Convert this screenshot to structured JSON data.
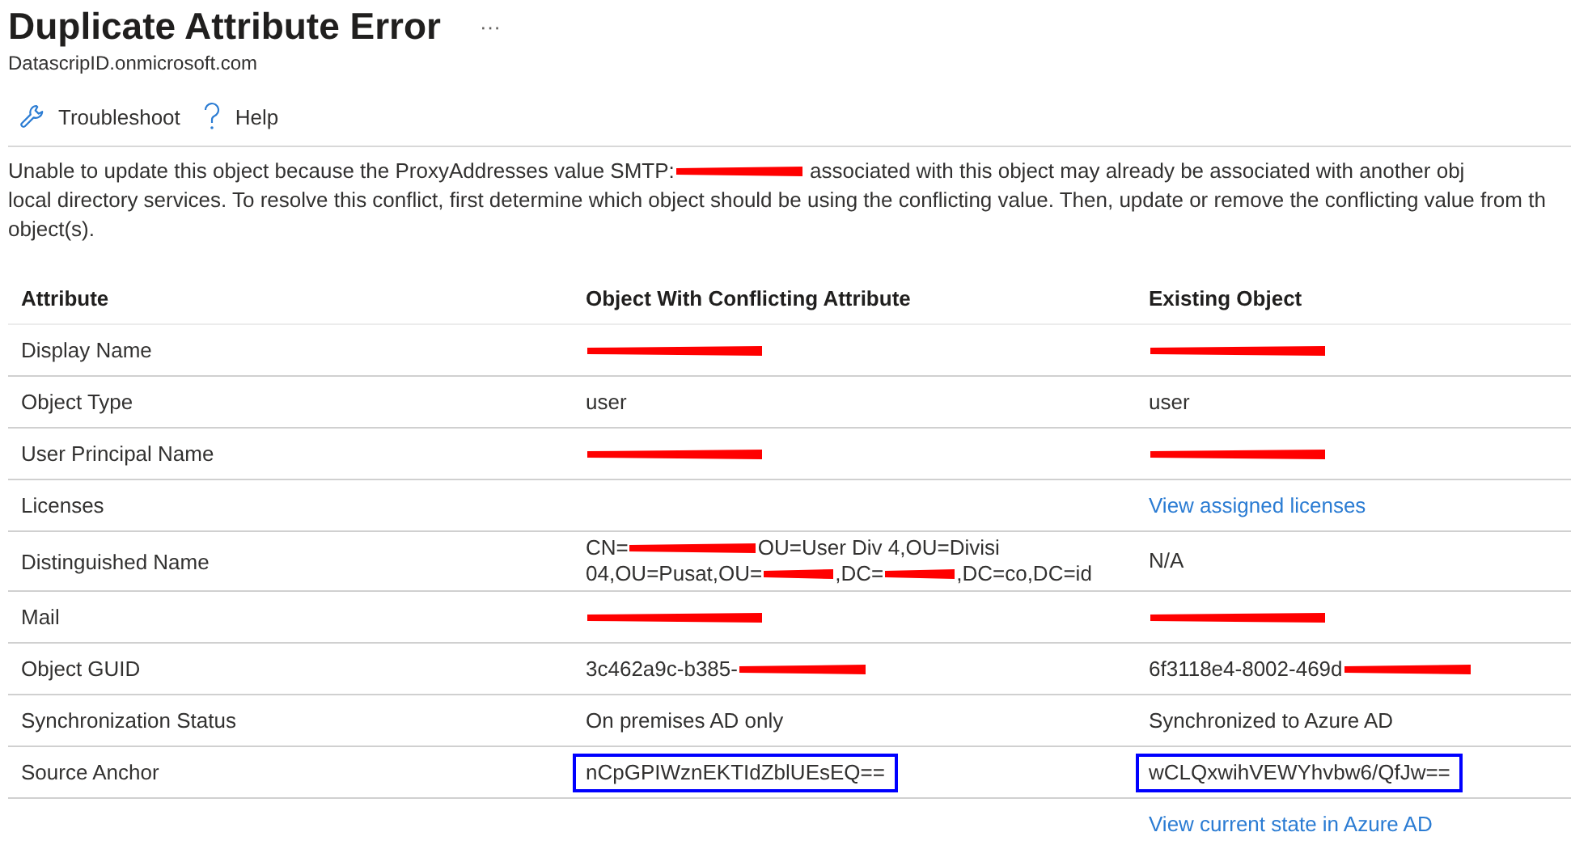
{
  "header": {
    "title": "Duplicate Attribute Error",
    "more": "···",
    "subtitle": "DatascripID.onmicrosoft.com"
  },
  "toolbar": [
    {
      "label": "Troubleshoot",
      "kind": "wrench"
    },
    {
      "label": "Help",
      "kind": "help"
    }
  ],
  "description": [
    [
      {
        "kind": "text",
        "text": "Unable to update this object because the ProxyAddresses value SMTP:"
      },
      {
        "kind": "redaction"
      },
      {
        "kind": "text",
        "text": " associated with this object may already be associated with another obj"
      }
    ],
    [
      {
        "kind": "text",
        "text": "local directory services. To resolve this conflict, first determine which object should be using the conflicting value. Then, update or remove the conflicting value from th"
      }
    ],
    [
      {
        "kind": "text",
        "text": "object(s)."
      }
    ]
  ],
  "table": {
    "columns": [
      "Attribute",
      "Object With Conflicting Attribute",
      "Existing Object"
    ],
    "rows": [
      {
        "attribute": "Display Name",
        "conflicting": {
          "highlighted": false,
          "lines": [
            [
              {
                "kind": "redaction"
              }
            ]
          ]
        },
        "existing": {
          "highlighted": false,
          "lines": [
            [
              {
                "kind": "redaction"
              }
            ]
          ]
        }
      },
      {
        "attribute": "Object Type",
        "conflicting": {
          "highlighted": false,
          "lines": [
            [
              {
                "kind": "text",
                "text": "user"
              }
            ]
          ]
        },
        "existing": {
          "highlighted": false,
          "lines": [
            [
              {
                "kind": "text",
                "text": "user"
              }
            ]
          ]
        }
      },
      {
        "attribute": "User Principal Name",
        "conflicting": {
          "highlighted": false,
          "lines": [
            [
              {
                "kind": "redaction"
              }
            ]
          ]
        },
        "existing": {
          "highlighted": false,
          "lines": [
            [
              {
                "kind": "redaction"
              }
            ]
          ]
        }
      },
      {
        "attribute": "Licenses",
        "existing": {
          "highlighted": false,
          "lines": [
            [
              {
                "kind": "link",
                "text": "View assigned licenses"
              }
            ]
          ]
        }
      },
      {
        "attribute": "Distinguished Name",
        "conflicting": {
          "highlighted": false,
          "lines": [
            [
              {
                "kind": "text",
                "text": "CN="
              },
              {
                "kind": "redaction"
              },
              {
                "kind": "text",
                "text": "OU=User Div 4,OU=Divisi"
              }
            ],
            [
              {
                "kind": "text",
                "text": "04,OU=Pusat,OU="
              },
              {
                "kind": "redaction"
              },
              {
                "kind": "text",
                "text": ",DC="
              },
              {
                "kind": "redaction"
              },
              {
                "kind": "text",
                "text": ",DC=co,DC=id"
              }
            ]
          ]
        },
        "existing": {
          "highlighted": false,
          "lines": [
            [
              {
                "kind": "text",
                "text": "N/A"
              }
            ]
          ]
        }
      },
      {
        "attribute": "Mail",
        "conflicting": {
          "highlighted": false,
          "lines": [
            [
              {
                "kind": "redaction"
              }
            ]
          ]
        },
        "existing": {
          "highlighted": false,
          "lines": [
            [
              {
                "kind": "redaction"
              }
            ]
          ]
        }
      },
      {
        "attribute": "Object GUID",
        "conflicting": {
          "highlighted": false,
          "lines": [
            [
              {
                "kind": "text",
                "text": "3c462a9c-b385-"
              },
              {
                "kind": "redaction"
              }
            ]
          ]
        },
        "existing": {
          "highlighted": false,
          "lines": [
            [
              {
                "kind": "text",
                "text": "6f3118e4-8002-469d"
              },
              {
                "kind": "redaction"
              }
            ]
          ]
        }
      },
      {
        "attribute": "Synchronization Status",
        "conflicting": {
          "highlighted": false,
          "lines": [
            [
              {
                "kind": "text",
                "text": "On premises AD only"
              }
            ]
          ]
        },
        "existing": {
          "highlighted": false,
          "lines": [
            [
              {
                "kind": "text",
                "text": "Synchronized to Azure AD"
              }
            ]
          ]
        }
      },
      {
        "attribute": "Source Anchor",
        "conflicting": {
          "highlighted": true,
          "lines": [
            [
              {
                "kind": "text",
                "text": "nCpGPIWznEKTIdZblUEsEQ=="
              }
            ]
          ]
        },
        "existing": {
          "highlighted": true,
          "lines": [
            [
              {
                "kind": "text",
                "text": "wCLQxwihVEWYhvbw6/QfJw=="
              }
            ]
          ]
        }
      }
    ],
    "footer_link": "View current state in Azure AD"
  }
}
